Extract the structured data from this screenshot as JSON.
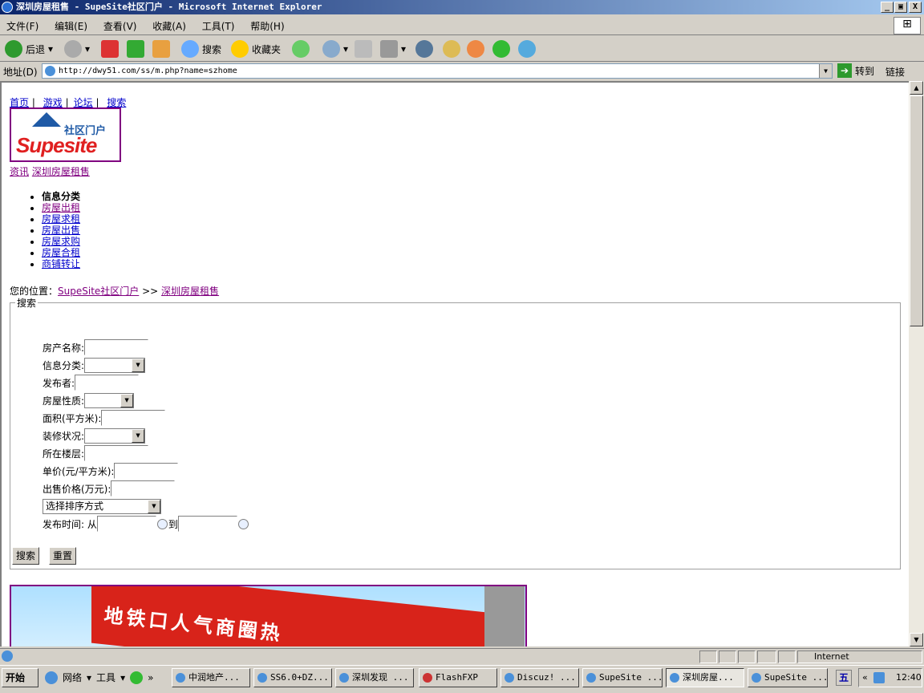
{
  "window": {
    "title": "深圳房屋租售 - SupeSite社区门户 - Microsoft Internet Explorer",
    "min": "_",
    "max": "▣",
    "close": "X"
  },
  "menu": [
    "文件(F)",
    "编辑(E)",
    "查看(V)",
    "收藏(A)",
    "工具(T)",
    "帮助(H)"
  ],
  "toolbar": {
    "back": "后退",
    "search": "搜索",
    "favorites": "收藏夹"
  },
  "address": {
    "label": "地址(D)",
    "url": "http://dwy51.com/ss/m.php?name=szhome",
    "go": "转到",
    "links": "链接"
  },
  "topnav": {
    "home": "首页",
    "sep1": "|",
    "games": "游戏",
    "sep2": "|",
    "forum": "论坛",
    "sep3": "|",
    "search": "搜索"
  },
  "logo": {
    "cn": "社区门户",
    "brand": "Supesite"
  },
  "crumb": {
    "news": "资讯",
    "current": "深圳房屋租售"
  },
  "categories": {
    "heading": "信息分类",
    "items": [
      "房屋出租",
      "房屋求租",
      "房屋出售",
      "房屋求购",
      "房屋合租",
      "商铺转让"
    ]
  },
  "location": {
    "label": "您的位置：",
    "home": "SupeSite社区门户",
    "arrow": ">>",
    "current": "深圳房屋租售"
  },
  "search": {
    "legend": "搜索",
    "fields": {
      "name": "房产名称:",
      "category": "信息分类:",
      "poster": "发布者:",
      "nature": "房屋性质:",
      "area": "面积(平方米):",
      "decor": "装修状况:",
      "floor": "所在楼层:",
      "unitprice": "单价(元/平方米):",
      "price": "出售价格(万元):",
      "time": "发布时间: 从",
      "to": "到"
    },
    "sort": "选择排序方式",
    "submit": "搜索",
    "reset": "重置"
  },
  "banner": {
    "text": "地铁口人气商圈热"
  },
  "status": {
    "zone": "Internet"
  },
  "taskbar": {
    "start": "开始",
    "network": "网络",
    "tools": "工具",
    "tasks": [
      "中润地产...",
      "SS6.0+DZ...",
      "深圳发现 ...",
      "FlashFXP",
      "Discuz! ...",
      "SupeSite ...",
      "深圳房屋...",
      "SupeSite ..."
    ],
    "ime": "五",
    "clock": "12:40"
  }
}
